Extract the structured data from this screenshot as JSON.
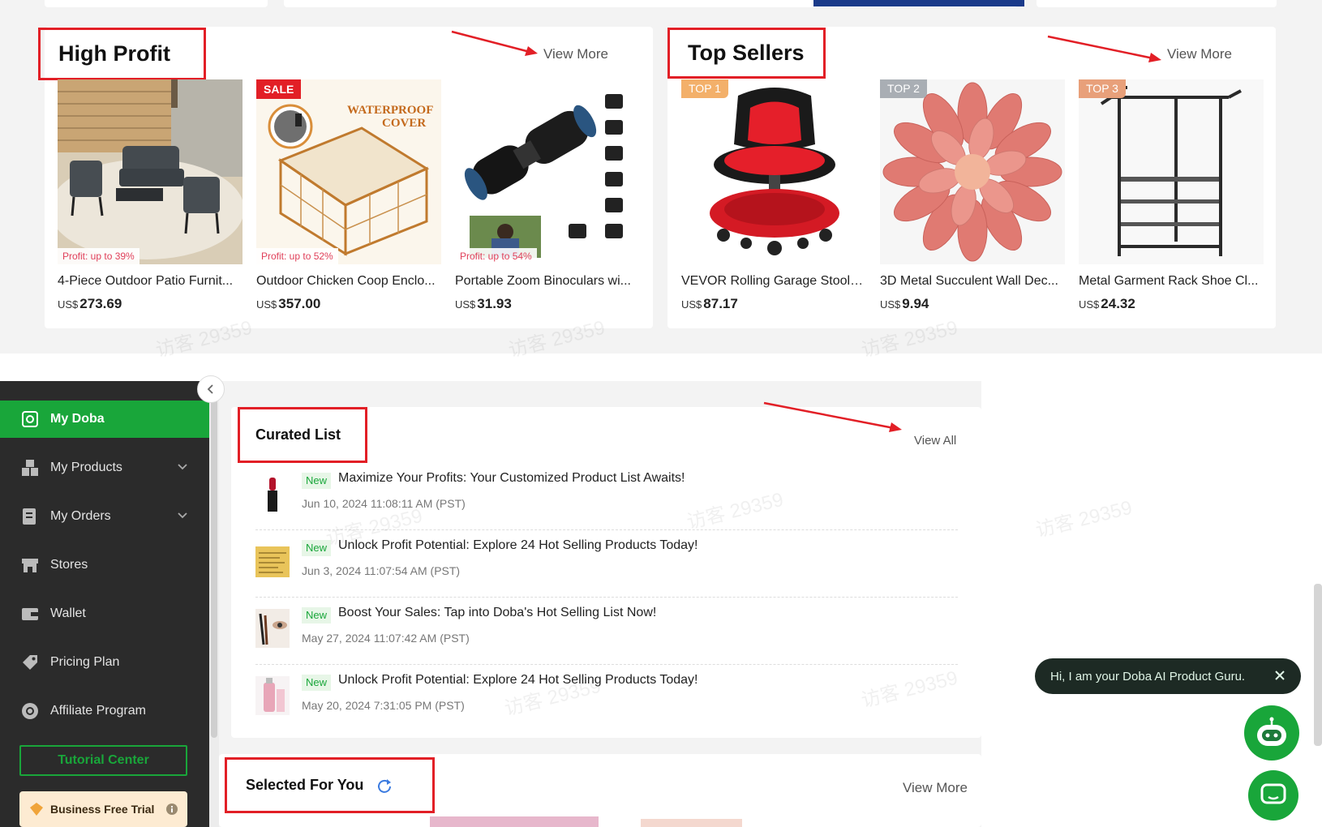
{
  "high_profit": {
    "title": "High Profit",
    "view_more": "View More",
    "products": [
      {
        "name": "4-Piece Outdoor Patio Furnit...",
        "currency": "US$",
        "price": "273.69",
        "profit": "Profit: up to 39%"
      },
      {
        "name": "Outdoor Chicken Coop Enclo...",
        "currency": "US$",
        "price": "357.00",
        "profit": "Profit: up to 52%",
        "sale": "SALE",
        "overlay": "WATERPROOF COVER"
      },
      {
        "name": "Portable Zoom Binoculars wi...",
        "currency": "US$",
        "price": "31.93",
        "profit": "Profit: up to 54%"
      }
    ]
  },
  "top_sellers": {
    "title": "Top Sellers",
    "view_more": "View More",
    "products": [
      {
        "rank": "TOP 1",
        "name": "VEVOR Rolling Garage Stool, ...",
        "currency": "US$",
        "price": "87.17"
      },
      {
        "rank": "TOP 2",
        "name": "3D Metal Succulent Wall Dec...",
        "currency": "US$",
        "price": "9.94"
      },
      {
        "rank": "TOP 3",
        "name": "Metal Garment Rack Shoe Cl...",
        "currency": "US$",
        "price": "24.32"
      }
    ]
  },
  "sidebar": {
    "items": [
      {
        "label": "My Doba",
        "icon": "my-doba-icon"
      },
      {
        "label": "My Products",
        "icon": "products-icon"
      },
      {
        "label": "My Orders",
        "icon": "orders-icon"
      },
      {
        "label": "Stores",
        "icon": "store-icon"
      },
      {
        "label": "Wallet",
        "icon": "wallet-icon"
      },
      {
        "label": "Pricing Plan",
        "icon": "tag-icon"
      },
      {
        "label": "Affiliate Program",
        "icon": "affiliate-icon"
      }
    ],
    "tutorial_center": "Tutorial Center",
    "business_trial": "Business Free Trial"
  },
  "curated_list": {
    "title": "Curated List",
    "view_all": "View All",
    "items": [
      {
        "badge": "New",
        "title": "Maximize Your Profits: Your Customized Product List Awaits!",
        "date": "Jun 10, 2024 11:08:11 AM (PST)"
      },
      {
        "badge": "New",
        "title": "Unlock Profit Potential: Explore 24 Hot Selling Products Today!",
        "date": "Jun 3, 2024 11:07:54 AM (PST)"
      },
      {
        "badge": "New",
        "title": "Boost Your Sales: Tap into Doba's Hot Selling List Now!",
        "date": "May 27, 2024 11:07:42 AM (PST)"
      },
      {
        "badge": "New",
        "title": "Unlock Profit Potential: Explore 24 Hot Selling Products Today!",
        "date": "May 20, 2024 7:31:05 PM (PST)"
      }
    ]
  },
  "selected_for_you": {
    "title": "Selected For You",
    "view_more": "View More"
  },
  "chat": {
    "greeting": "Hi, I am your Doba AI Product Guru."
  },
  "watermark": "访客 29359",
  "colors": {
    "accent_green": "#19a63a",
    "annotation_red": "#e21f26",
    "sidebar_bg": "#2b2b2b"
  }
}
